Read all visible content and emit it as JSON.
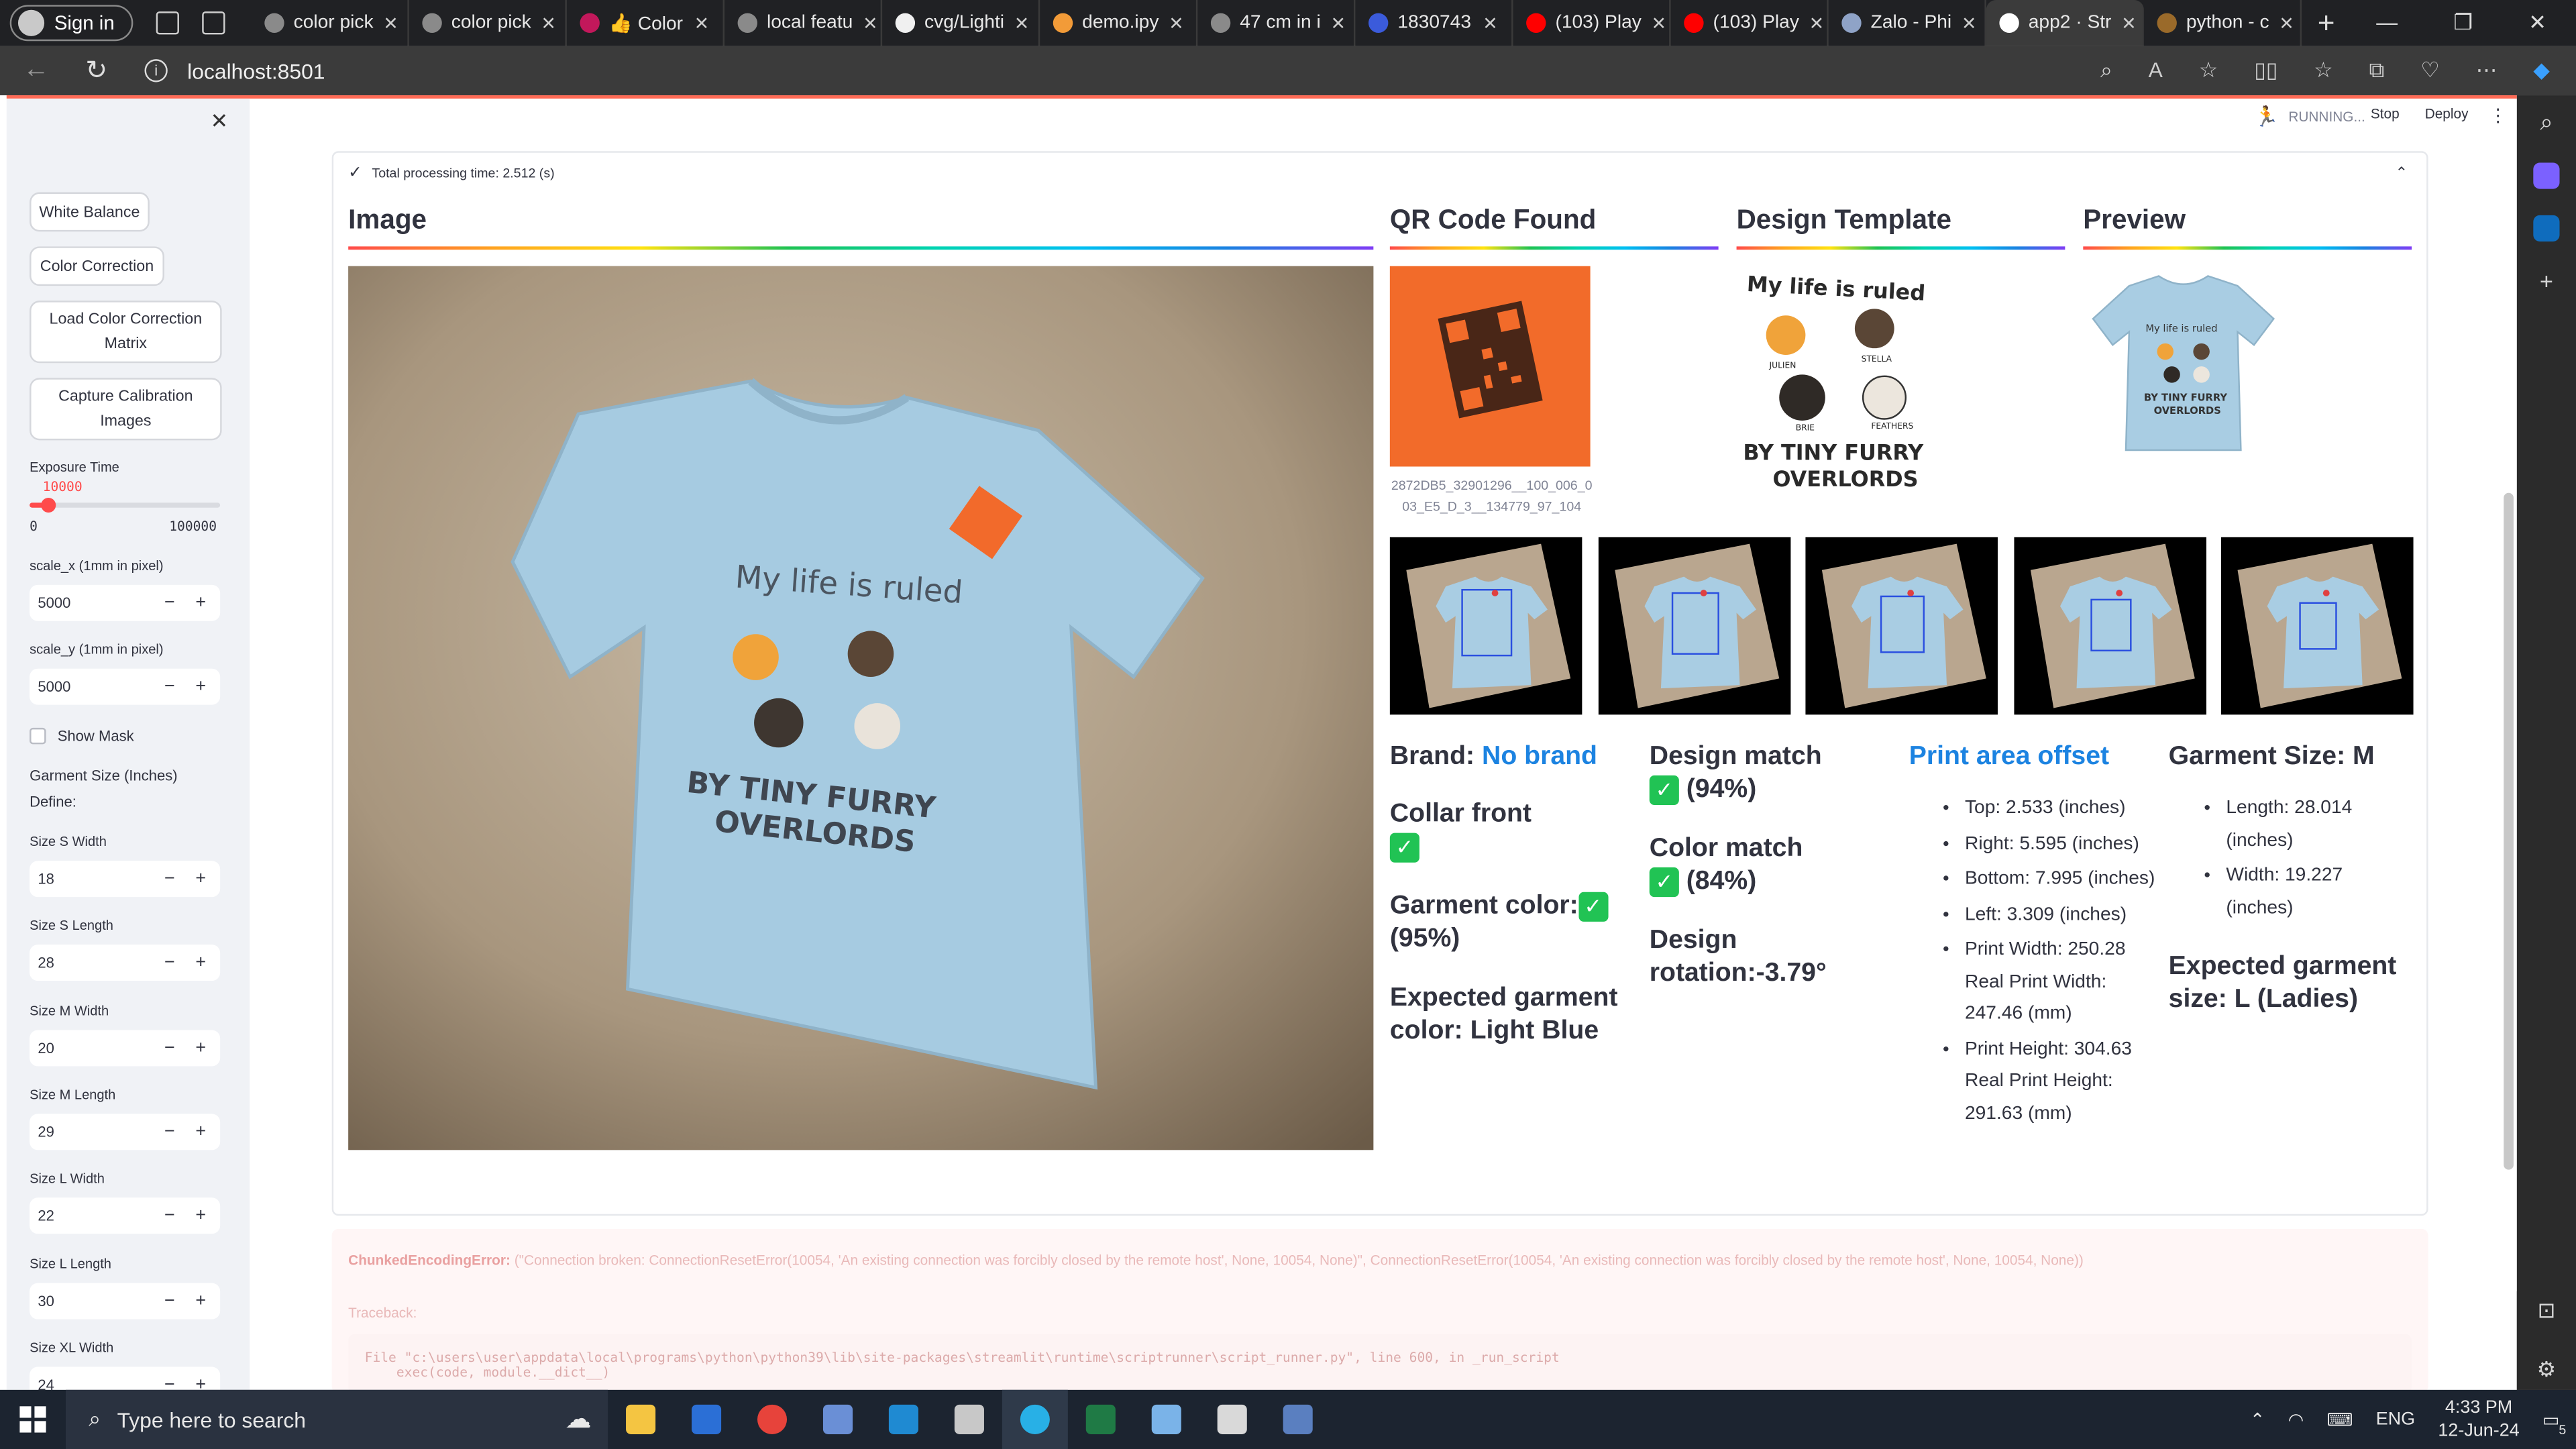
{
  "browser": {
    "signin": "Sign in",
    "tabs": [
      {
        "title": "color pick",
        "color": "#8a8a8a"
      },
      {
        "title": "color pick",
        "color": "#8a8a8a"
      },
      {
        "title": "👍 Color",
        "color": "#c2185b"
      },
      {
        "title": "local featu",
        "color": "#8a8a8a"
      },
      {
        "title": "cvg/Lighti",
        "color": "#f0f0f0"
      },
      {
        "title": "demo.ipy",
        "color": "#f29b38"
      },
      {
        "title": "47 cm in i",
        "color": "#8a8a8a"
      },
      {
        "title": "1830743",
        "color": "#3b5bdb"
      },
      {
        "title": "(103) Play",
        "color": "#ff0000"
      },
      {
        "title": "(103) Play",
        "color": "#ff0000"
      },
      {
        "title": "Zalo - Phi",
        "color": "#8fa3c7"
      },
      {
        "title": "app2 · Str",
        "color": "#ffffff"
      },
      {
        "title": "python - c",
        "color": "#9a6a2a"
      }
    ],
    "url": "localhost:8501"
  },
  "sidebar": {
    "buttons": {
      "white_balance": "White Balance",
      "color_correction": "Color Correction",
      "load_ccm": "Load Color Correction Matrix",
      "capture_calibration": "Capture Calibration Images"
    },
    "exposure": {
      "label": "Exposure Time",
      "value": "10000",
      "min": "0",
      "max": "100000",
      "fraction": 0.1
    },
    "scale_x": {
      "label": "scale_x (1mm in pixel)",
      "value": "5000"
    },
    "scale_y": {
      "label": "scale_y (1mm in pixel)",
      "value": "5000"
    },
    "show_mask": "Show Mask",
    "garment_size_title": "Garment Size (Inches)",
    "define": "Define:",
    "sizes": [
      {
        "label": "Size S Width",
        "value": "18"
      },
      {
        "label": "Size S Length",
        "value": "28"
      },
      {
        "label": "Size M Width",
        "value": "20"
      },
      {
        "label": "Size M Length",
        "value": "29"
      },
      {
        "label": "Size L Width",
        "value": "22"
      },
      {
        "label": "Size L Length",
        "value": "30"
      },
      {
        "label": "Size XL Width",
        "value": "24"
      }
    ]
  },
  "header": {
    "running": "RUNNING...",
    "stop": "Stop",
    "deploy": "Deploy"
  },
  "status": {
    "processing": "Total processing time: 2.512 (s)"
  },
  "columns": {
    "image": "Image",
    "qr": "QR Code Found",
    "design": "Design Template",
    "preview": "Preview"
  },
  "qr_caption": "2872DB5_32901296__100_006_003_E5_D_3__134779_97_104",
  "design_text": {
    "line1": "My life is ruled",
    "line2": "BY TINY FURRY",
    "line3": "OVERLORDS",
    "names": [
      "JULIEN",
      "STELLA",
      "BRIE",
      "FEATHERS"
    ]
  },
  "results": {
    "brand_label": "Brand:",
    "brand_value": "No brand",
    "collar": "Collar front",
    "garment_color": "Garment color:",
    "garment_color_pct": "(95%)",
    "expected_color": "Expected garment color: Light Blue",
    "design_match": "Design match",
    "design_match_pct": "(94%)",
    "color_match": "Color match",
    "color_match_pct": "(84%)",
    "design_rotation": "Design rotation:-3.79°",
    "print_offset_title": "Print area offset",
    "offsets": [
      "Top: 2.533 (inches)",
      "Right: 5.595 (inches)",
      "Bottom: 7.995 (inches)",
      "Left: 3.309 (inches)",
      "Print Width: 250.28 Real Print Width: 247.46 (mm)",
      "Print Height: 304.63 Real Print Height: 291.63 (mm)"
    ],
    "garment_size": "Garment Size: M",
    "size_items": [
      "Length: 28.014 (inches)",
      "Width: 19.227 (inches)"
    ],
    "expected_size": "Expected garment size: L (Ladies)"
  },
  "error": {
    "type": "ChunkedEncodingError:",
    "message": "(\"Connection broken: ConnectionResetError(10054, 'An existing connection was forcibly closed by the remote host', None, 10054, None)\", ConnectionResetError(10054, 'An existing connection was forcibly closed by the remote host', None, 10054, None))",
    "traceback_label": "Traceback:",
    "code": "File \"c:\\users\\user\\appdata\\local\\programs\\python\\python39\\lib\\site-packages\\streamlit\\runtime\\scriptrunner\\script_runner.py\", line 600, in _run_script\n    exec(code, module.__dict__)"
  },
  "taskbar": {
    "search": "Type here to search",
    "lang": "ENG",
    "time": "4:33 PM",
    "date": "12-Jun-24",
    "notif": "5"
  },
  "colors": {
    "accent": "#ff4b4b",
    "link": "#1c83e1",
    "success": "#21c354",
    "shirt": "#a9cde3"
  }
}
